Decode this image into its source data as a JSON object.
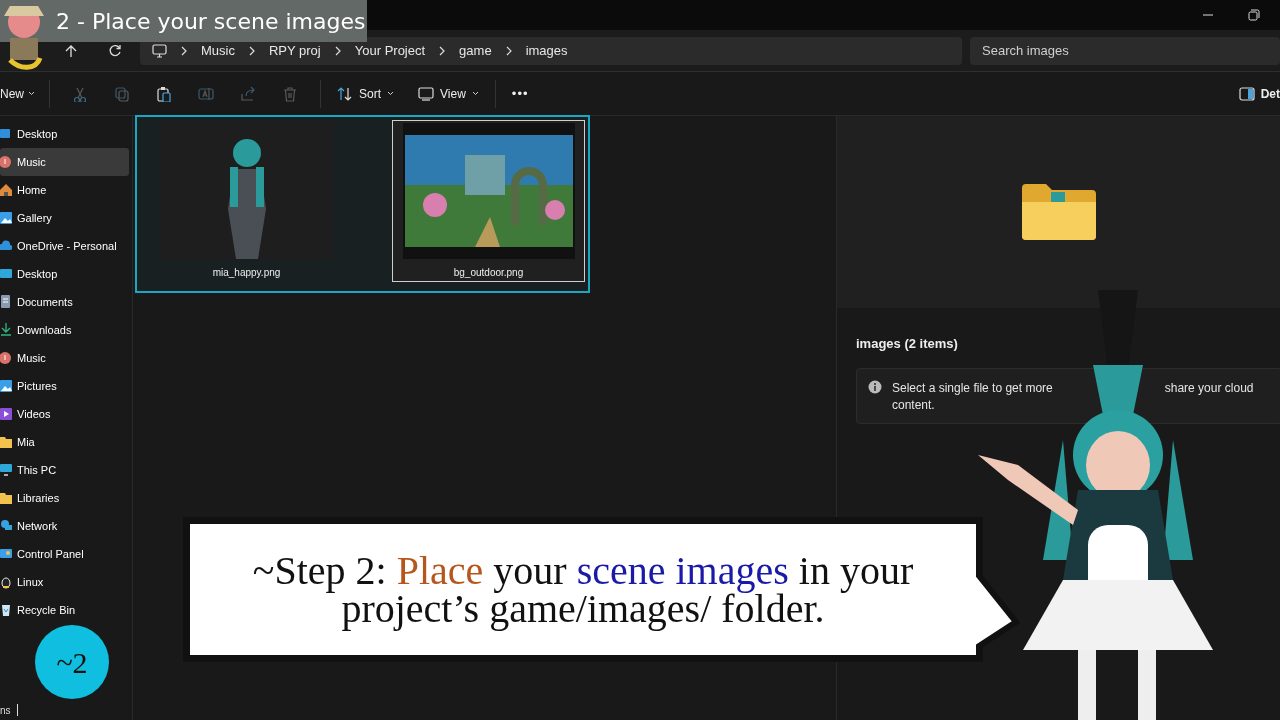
{
  "overlay_title": "2 - Place your scene images",
  "address_bar": {
    "breadcrumbs": [
      "Music",
      "RPY proj",
      "Your Project",
      "game",
      "images"
    ]
  },
  "search": {
    "placeholder": "Search images"
  },
  "toolbar": {
    "new": "New",
    "sort": "Sort",
    "view": "View",
    "more": "•••",
    "details": "Det"
  },
  "sidebar": {
    "items": [
      {
        "label": "Desktop",
        "selected": false
      },
      {
        "label": "Music",
        "selected": true
      },
      {
        "label": "Home",
        "selected": false
      },
      {
        "label": "Gallery",
        "selected": false
      },
      {
        "label": "OneDrive - Personal",
        "selected": false
      },
      {
        "label": "Desktop",
        "selected": false
      },
      {
        "label": "Documents",
        "selected": false
      },
      {
        "label": "Downloads",
        "selected": false
      },
      {
        "label": "Music",
        "selected": false
      },
      {
        "label": "Pictures",
        "selected": false
      },
      {
        "label": "Videos",
        "selected": false
      },
      {
        "label": "Mia",
        "selected": false
      },
      {
        "label": "This PC",
        "selected": false
      },
      {
        "label": "Libraries",
        "selected": false
      },
      {
        "label": "Network",
        "selected": false
      },
      {
        "label": "Control Panel",
        "selected": false
      },
      {
        "label": "Linux",
        "selected": false
      },
      {
        "label": "Recycle Bin",
        "selected": false
      }
    ]
  },
  "files": [
    {
      "name": "mia_happy.png",
      "kind": "character",
      "focused": false
    },
    {
      "name": "bg_outdoor.png",
      "kind": "landscape",
      "focused": true
    }
  ],
  "details_pane": {
    "title": "images (2 items)",
    "info_parts": [
      "Select a single file to get more",
      "share your cloud",
      "content."
    ]
  },
  "caption": {
    "segments": [
      {
        "text": "~Step 2: ",
        "color": "#111111"
      },
      {
        "text": "Place",
        "color": "#b5561c"
      },
      {
        "text": " your ",
        "color": "#111111"
      },
      {
        "text": "scene images",
        "color": "#1a1aa8"
      },
      {
        "text": " in your project’s game/images/ folder.",
        "color": "#111111"
      }
    ]
  },
  "step_badge": "~2",
  "status_bar": "ns"
}
